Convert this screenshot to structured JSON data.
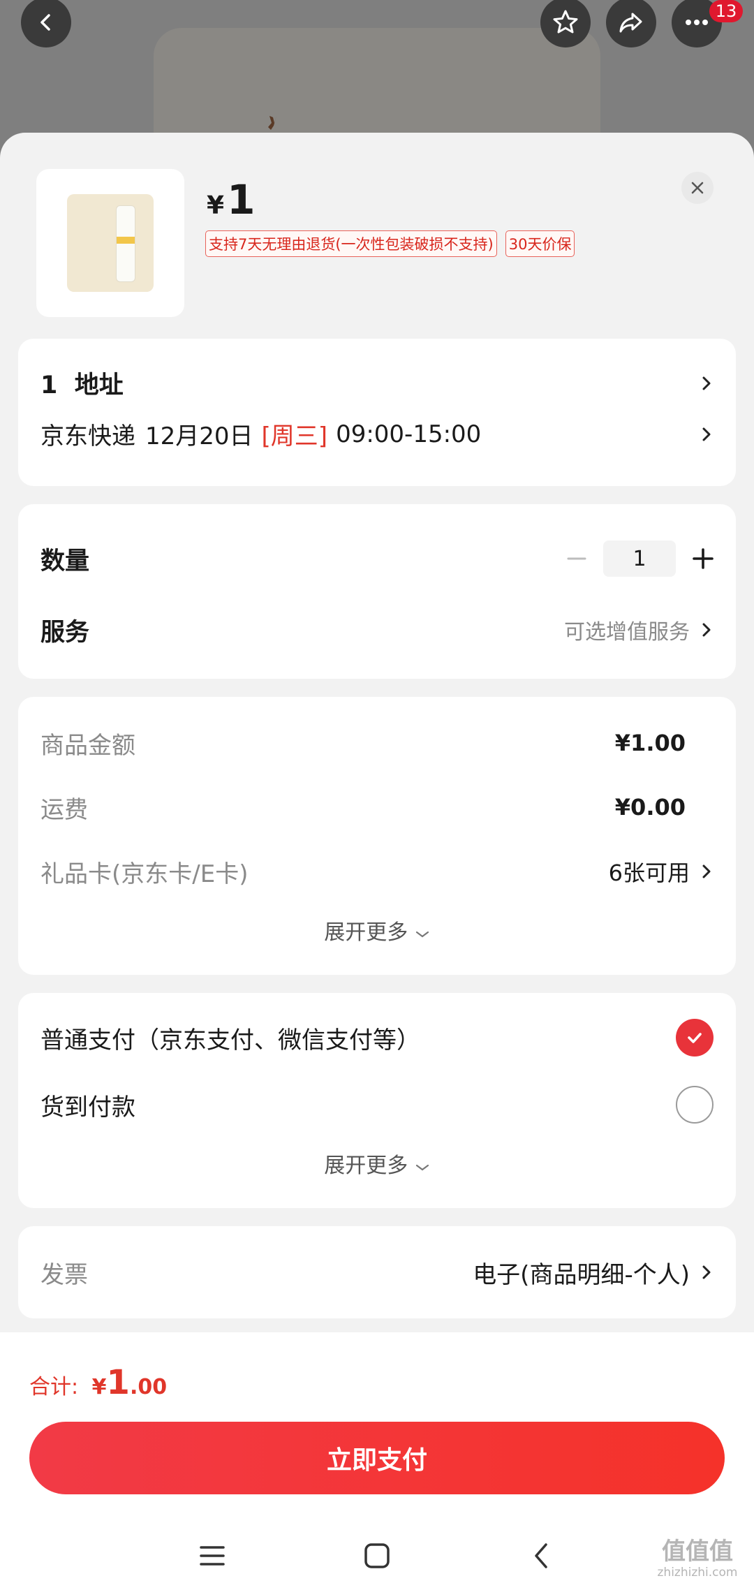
{
  "top_bar": {
    "more_badge": "13",
    "icons": [
      "back-icon",
      "star-icon",
      "share-icon",
      "more-icon"
    ]
  },
  "product": {
    "currency": "¥",
    "price": "1",
    "tags": [
      "支持7天无理由退货(一次性包装破损不支持)",
      "30天价保"
    ]
  },
  "address": {
    "title": "1  地址",
    "delivery_carrier": "京东快递",
    "delivery_date": "12月20日",
    "delivery_weekday": "[周三]",
    "delivery_time": "09:00-15:00"
  },
  "options": {
    "quantity_label": "数量",
    "quantity_value": "1",
    "service_label": "服务",
    "service_value": "可选增值服务"
  },
  "costs": {
    "items": [
      {
        "label": "商品金额",
        "value": "¥1.00"
      },
      {
        "label": "运费",
        "value": "¥0.00"
      },
      {
        "label": "礼品卡(京东卡/E卡)",
        "value": "6张可用"
      }
    ],
    "expand_label": "展开更多"
  },
  "payment": {
    "methods": [
      {
        "label": "普通支付（京东支付、微信支付等）",
        "selected": true
      },
      {
        "label": "货到付款",
        "selected": false
      }
    ],
    "expand_label": "展开更多"
  },
  "invoice": {
    "label": "发票",
    "value": "电子(商品明细-个人)"
  },
  "footer": {
    "total_label": "合计:",
    "total_currency": "¥",
    "total_int": "1",
    "total_dec": ".00",
    "pay_button": "立即支付"
  },
  "watermark": {
    "text_top": "值值值",
    "text_bottom": "zhizhizhi.com"
  },
  "colors": {
    "accent": "#e8333a",
    "price_red": "#e0362a",
    "sheet_bg": "#f2f2f2"
  }
}
